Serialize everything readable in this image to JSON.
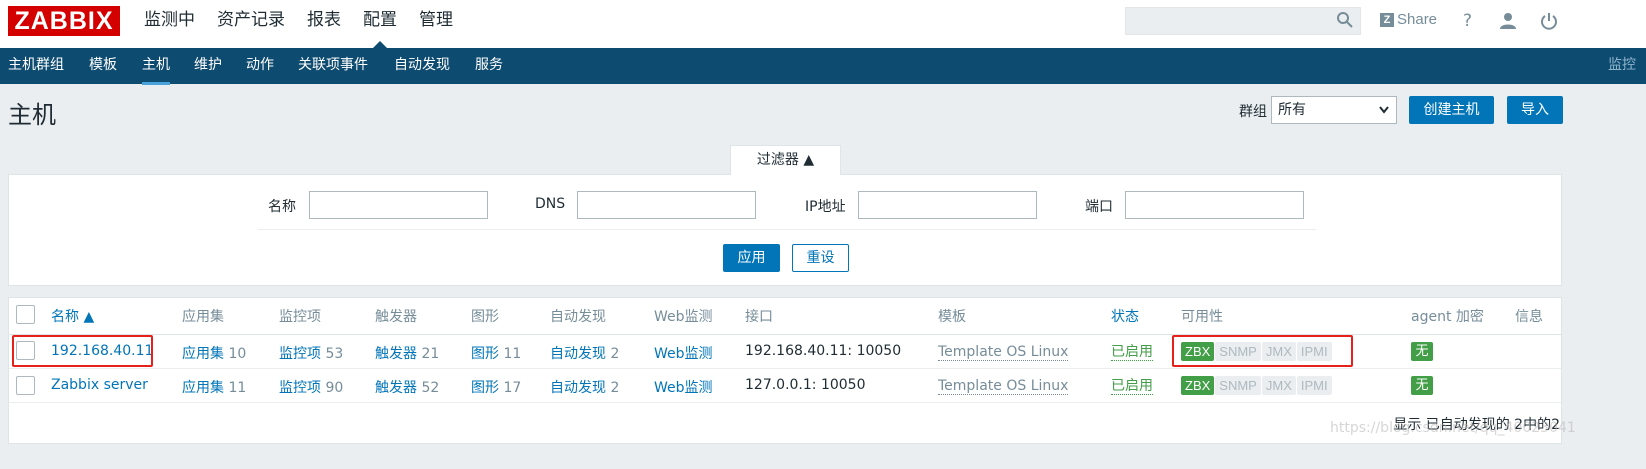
{
  "brand": {
    "logo": "ZABBIX"
  },
  "main_nav": [
    "监测中",
    "资产记录",
    "报表",
    "配置",
    "管理"
  ],
  "top_right": {
    "share": "Share",
    "help": "?"
  },
  "sub_nav": [
    "主机群组",
    "模板",
    "主机",
    "维护",
    "动作",
    "关联项事件",
    "自动发现",
    "服务"
  ],
  "sub_nav_right": "监控",
  "header": {
    "title": "主机",
    "group_label": "群组",
    "group_value": "所有",
    "create_button": "创建主机",
    "import_button": "导入"
  },
  "filter": {
    "tab_label": "过滤器 ▲",
    "fields": [
      {
        "label": "名称",
        "value": ""
      },
      {
        "label": "DNS",
        "value": ""
      },
      {
        "label": "IP地址",
        "value": ""
      },
      {
        "label": "端口",
        "value": ""
      }
    ],
    "apply": "应用",
    "reset": "重设"
  },
  "table": {
    "columns": [
      "名称 ▲",
      "应用集",
      "监控项",
      "触发器",
      "图形",
      "自动发现",
      "Web监测",
      "接口",
      "模板",
      "状态",
      "可用性",
      "agent 加密",
      "信息"
    ],
    "rows": [
      {
        "name": "192.168.40.11",
        "apps_label": "应用集",
        "apps_count": "10",
        "items_label": "监控项",
        "items_count": "53",
        "triggers_label": "触发器",
        "triggers_count": "21",
        "graphs_label": "图形",
        "graphs_count": "11",
        "discovery_label": "自动发现",
        "discovery_count": "2",
        "web": "Web监测",
        "interface": "192.168.40.11: 10050",
        "template": "Template OS Linux",
        "status": "已启用",
        "availability": [
          "ZBX",
          "SNMP",
          "JMX",
          "IPMI"
        ],
        "encryption": "无"
      },
      {
        "name": "Zabbix server",
        "apps_label": "应用集",
        "apps_count": "11",
        "items_label": "监控项",
        "items_count": "90",
        "triggers_label": "触发器",
        "triggers_count": "52",
        "graphs_label": "图形",
        "graphs_count": "17",
        "discovery_label": "自动发现",
        "discovery_count": "2",
        "web": "Web监测",
        "interface": "127.0.0.1: 10050",
        "template": "Template OS Linux",
        "status": "已启用",
        "availability": [
          "ZBX",
          "SNMP",
          "JMX",
          "IPMI"
        ],
        "encryption": "无"
      }
    ],
    "footer": "显示 已自动发现的 2中的2"
  },
  "watermark": "https://blog.csdn.net/qq_40023041",
  "colors": {
    "brand_red": "#d40000",
    "nav_dark": "#0e4b70",
    "link_blue": "#0275b8",
    "status_green": "#429e47",
    "annotation_red": "#e8201c"
  }
}
